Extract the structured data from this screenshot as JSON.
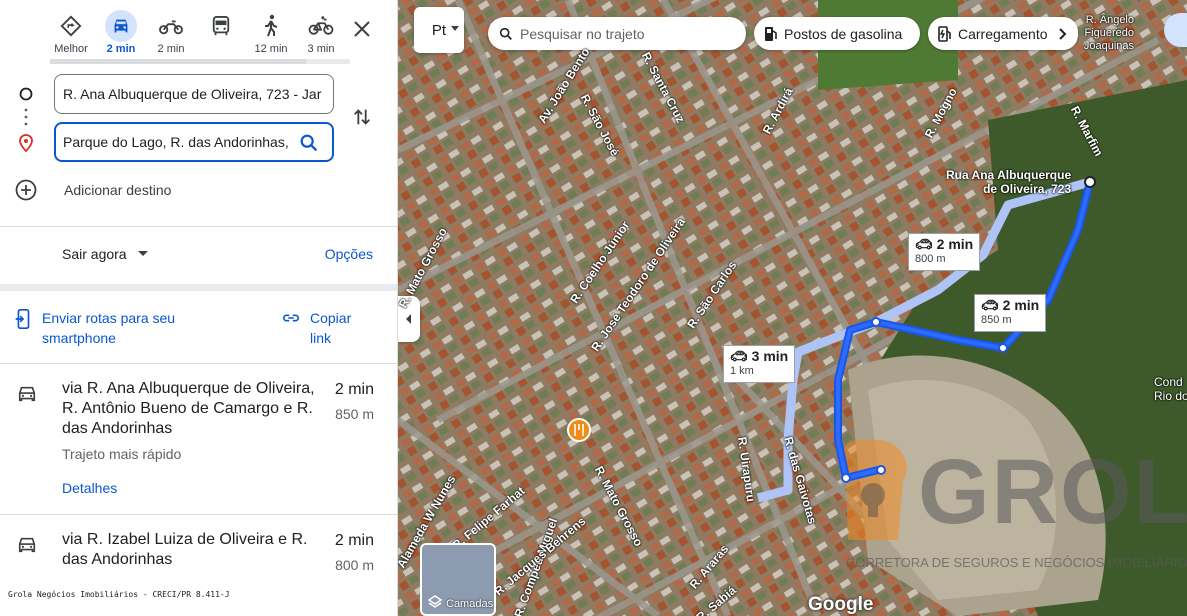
{
  "travel_modes": [
    {
      "name": "best",
      "label": "Melhor",
      "icon": "diamond-directions-icon",
      "active": false
    },
    {
      "name": "car",
      "label": "2 min",
      "icon": "car-icon",
      "active": true
    },
    {
      "name": "motorcycle",
      "label": "2 min",
      "icon": "motorcycle-icon",
      "active": false
    },
    {
      "name": "transit",
      "label": "",
      "icon": "bus-icon",
      "active": false
    },
    {
      "name": "walk",
      "label": "12 min",
      "icon": "walk-icon",
      "active": false
    },
    {
      "name": "bike",
      "label": "3 min",
      "icon": "bike-icon",
      "active": false
    }
  ],
  "origin": "R. Ana Albuquerque de Oliveira, 723 - Jar",
  "destination": "Parque do Lago, R. das Andorinhas,",
  "add_destination": "Adicionar destino",
  "depart": "Sair agora",
  "options": "Opções",
  "send_routes": "Enviar rotas para seu smartphone",
  "copy_link": "Copiar link",
  "routes": [
    {
      "via": "via R. Ana Albuquerque de Oliveira, R. Antônio Bueno de Camargo e R. das Andorinhas",
      "time": "2 min",
      "distance": "850 m",
      "note": "Trajeto mais rápido",
      "details": "Detalhes"
    },
    {
      "via": "via R. Izabel Luiza de Oliveira e R. das Andorinhas",
      "time": "2 min",
      "distance": "800 m"
    }
  ],
  "footer": "Grola Negócios Imobiliários - CRECI/PR 8.411-J",
  "map": {
    "search_placeholder": "Pesquisar no trajeto",
    "chips": [
      "Postos de gasolina",
      "Carregamento"
    ],
    "pt_label": "Pt",
    "layers": "Camadas",
    "google": "Google",
    "start_label_1": "Rua Ana Albuquerque",
    "start_label_2": "de Oliveira, 723",
    "tags": [
      {
        "time": "2 min",
        "dist": "800 m"
      },
      {
        "time": "2 min",
        "dist": "850 m"
      },
      {
        "time": "3 min",
        "dist": "1 km"
      }
    ],
    "streets": [
      "Av. João Bento",
      "R. São José",
      "R. Santa Cruz",
      "R. Ardirá",
      "R. Mogno",
      "R. Marfim",
      "R. Coelho Júnior",
      "R. José Teodoro de Oliveira",
      "R. São Carlos",
      "R. Mato Grosso",
      "R. Mato Grosso",
      "R. Uirapuru",
      "R. das Gaivotas",
      "R. Araras",
      "R. Sabiá",
      "R. Compeu Miguel",
      "R. Jacques Behrens",
      "R. Felipe Farhat",
      "Alameda W Nunes",
      "R. Ângelo Figueredo Joaquinas"
    ],
    "right_edge": [
      "Cond",
      "Rio do"
    ],
    "watermark": "GROLA",
    "watermark_sub": "CORRETORA DE SEGUROS E NEGÓCIOS IMOBILIÁRIOS"
  }
}
